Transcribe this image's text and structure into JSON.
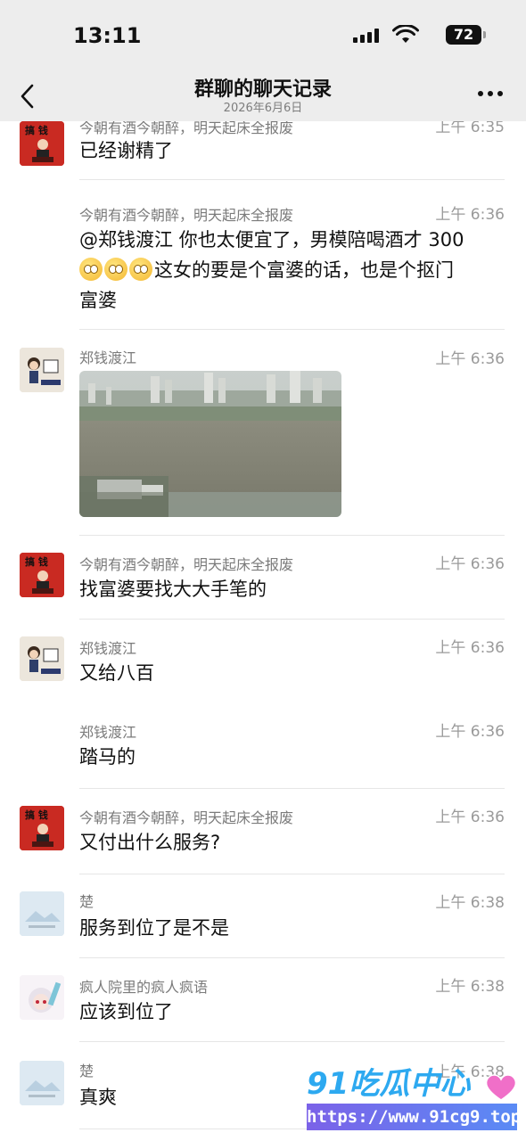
{
  "status_bar": {
    "time": "13:11",
    "battery": "72",
    "icons": [
      "signal-icon",
      "wifi-icon",
      "battery-icon"
    ]
  },
  "nav": {
    "title": "群聊的聊天记录",
    "subtitle": "2026年6月6日",
    "back_icon": "back-chevron-icon",
    "more_icon": "more-icon"
  },
  "messages": [
    {
      "sender": "今朝有酒今朝醉，明天起床全报废",
      "time": "上午 6:35",
      "text": "已经谢精了",
      "avatar": "red"
    },
    {
      "sender": "今朝有酒今朝醉，明天起床全报废",
      "time": "上午 6:36",
      "text_line1": "@郑钱渡江 你也太便宜了，男模陪喝酒才 300",
      "text_line2": "这女的要是个富婆的话，也是个抠门",
      "text_line3": "富婆",
      "emoji_count": 3,
      "avatar": "none"
    },
    {
      "sender": "郑钱渡江",
      "time": "上午 6:36",
      "image": "river-cityscape-photo",
      "avatar": "cartoon"
    },
    {
      "sender": "今朝有酒今朝醉，明天起床全报废",
      "time": "上午 6:36",
      "text": "找富婆要找大大手笔的",
      "avatar": "red"
    },
    {
      "sender": "郑钱渡江",
      "time": "上午 6:36",
      "text": "又给八百",
      "avatar": "cartoon"
    },
    {
      "sender": "郑钱渡江",
      "time": "上午 6:36",
      "text": "踏马的",
      "avatar": "none"
    },
    {
      "sender": "今朝有酒今朝醉，明天起床全报废",
      "time": "上午 6:36",
      "text": "又付出什么服务?",
      "avatar": "red"
    },
    {
      "sender": "楚",
      "time": "上午 6:38",
      "text": "服务到位了是不是",
      "avatar": "placeholder"
    },
    {
      "sender": "疯人院里的疯人疯语",
      "time": "上午 6:38",
      "text": "应该到位了",
      "avatar": "anime"
    },
    {
      "sender": "楚",
      "time": "上午 6:38",
      "text": "真爽",
      "avatar": "placeholder"
    }
  ],
  "watermark": {
    "logo_text": "91吃瓜中心",
    "url": "https://www.91cg9.top"
  },
  "colors": {
    "header_bg": "#ededed",
    "text": "#111111",
    "meta": "#7b7b7b",
    "divider": "#e6e6e6",
    "avatar_red": "#c92a22"
  }
}
